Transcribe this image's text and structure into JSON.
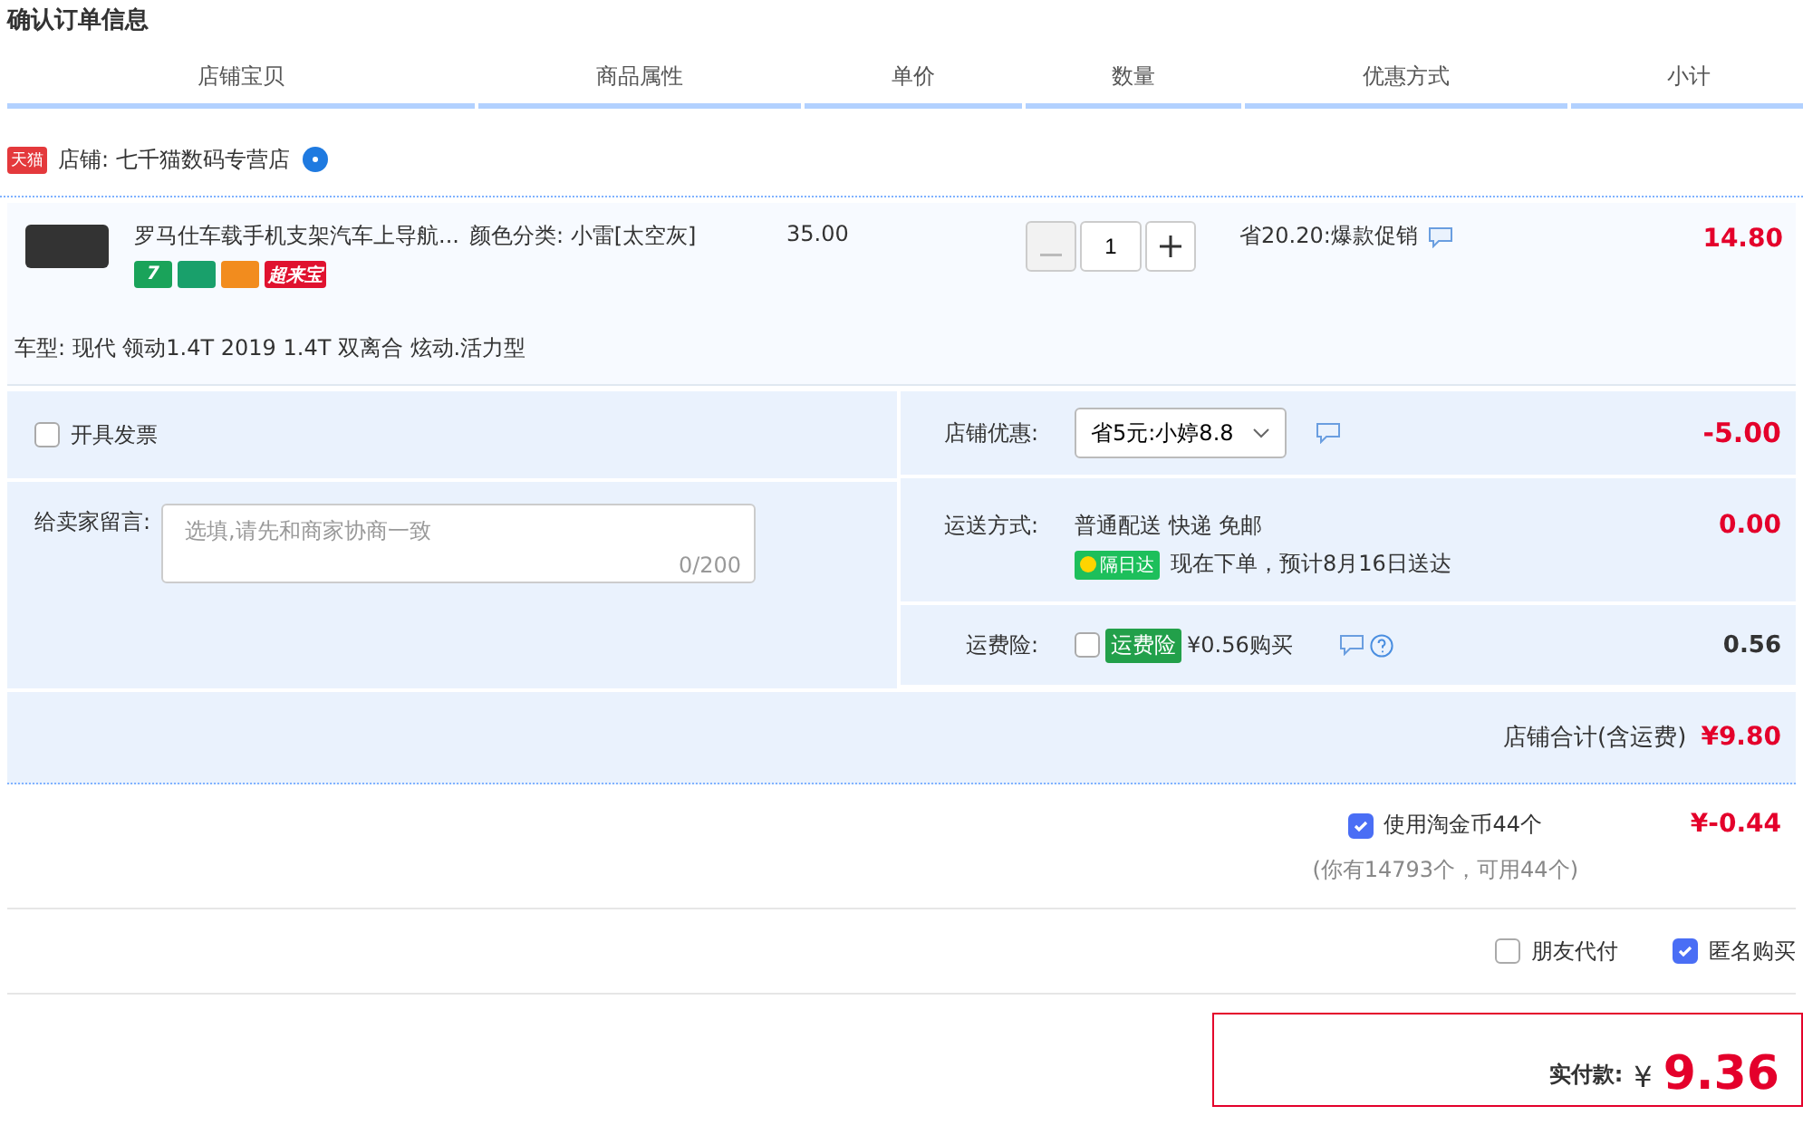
{
  "title": "确认订单信息",
  "columns": [
    "店铺宝贝",
    "商品属性",
    "单价",
    "数量",
    "优惠方式",
    "小计"
  ],
  "shop": {
    "badge": "天猫",
    "name": "店铺: 七千猫数码专营店"
  },
  "item": {
    "name": "罗马仕车载手机支架汽车上导航...",
    "attr": "颜色分类: 小雷[太空灰]",
    "price": "35.00",
    "quantity": "1",
    "decrease_disabled": true,
    "promo": "省20.20:爆款促销",
    "subtotal": "14.80",
    "tags": [
      {
        "kind": "seven",
        "text": "7"
      },
      {
        "kind": "shield"
      },
      {
        "kind": "card"
      },
      {
        "kind": "brand",
        "text": "超来宝"
      }
    ],
    "car": "车型: 现代 领动1.4T 2019 1.4T 双离合 炫动.活力型"
  },
  "invoice": {
    "label": "开具发票",
    "checked": false
  },
  "message": {
    "label": "给卖家留言:",
    "placeholder": "选填,请先和商家协商一致",
    "count": "0/200"
  },
  "discount": {
    "label": "店铺优惠:",
    "value": "省5元:小婷8.8",
    "amount": "-5.00"
  },
  "shipping": {
    "label": "运送方式:",
    "method": "普通配送 快递 免邮",
    "badge": "隔日达",
    "eta": "现在下单，预计8月16日送达",
    "amount": "0.00"
  },
  "insurance": {
    "label": "运费险:",
    "checked": false,
    "tag": "运费险",
    "price": "¥0.56购买",
    "amount": "0.56"
  },
  "shop_total": {
    "label": "店铺合计(含运费)",
    "amount": "¥9.80"
  },
  "coins": {
    "label": "使用淘金币44个",
    "checked": true,
    "note": "(你有14793个，可用44个)",
    "amount": "¥-0.44"
  },
  "options": [
    {
      "label": "朋友代付",
      "checked": false
    },
    {
      "label": "匿名购买",
      "checked": true
    }
  ],
  "pay": {
    "label": "实付款:",
    "currency": "¥",
    "amount": "9.36"
  }
}
